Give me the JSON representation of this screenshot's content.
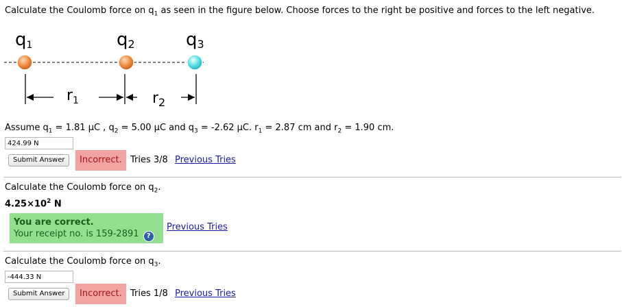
{
  "problem1": {
    "prompt_start": "Calculate the Coulomb force on q",
    "prompt_sub": "1",
    "prompt_end": " as seen in the figure below. Choose forces to the right be positive and forces to the left negative."
  },
  "figure": {
    "labels": {
      "q1": "q",
      "q1_sub": "1",
      "q2": "q",
      "q2_sub": "2",
      "q3": "q",
      "q3_sub": "3",
      "r1": "r",
      "r1_sub": "1",
      "r2": "r",
      "r2_sub": "2"
    },
    "colors": {
      "charge_positive": "#f0934a",
      "charge_negative": "#5fe2e8",
      "line": "#000000"
    }
  },
  "assumptions": {
    "t1": "Assume q",
    "s1": "1",
    "t2": " = 1.81 µC , q",
    "s2": "2",
    "t3": " = 5.00 µC and q",
    "s3": "3",
    "t4": " = -2.62 µC. r",
    "s4": "1",
    "t5": " = 2.87 cm and r",
    "s5": "2",
    "t6": " = 1.90 cm."
  },
  "part1": {
    "input_value": "424.99 N",
    "submit_label": "Submit Answer",
    "status": "Incorrect.",
    "tries": "Tries 3/8",
    "previous_tries": "Previous Tries"
  },
  "part2": {
    "prompt_start": "Calculate the Coulomb force on q",
    "prompt_sub": "2",
    "prompt_end": ".",
    "answer_base": "4.25×10",
    "answer_exp": "2",
    "answer_unit": " N",
    "correct_title": "You are correct.",
    "receipt": "Your receipt no. is 159-2891",
    "help_icon": "?",
    "previous_tries": "Previous Tries"
  },
  "part3": {
    "prompt_start": "Calculate the Coulomb force on q",
    "prompt_sub": "3",
    "prompt_end": ".",
    "input_value": "-444.33 N",
    "submit_label": "Submit Answer",
    "status": "Incorrect.",
    "tries": "Tries 1/8",
    "previous_tries": "Previous Tries"
  }
}
